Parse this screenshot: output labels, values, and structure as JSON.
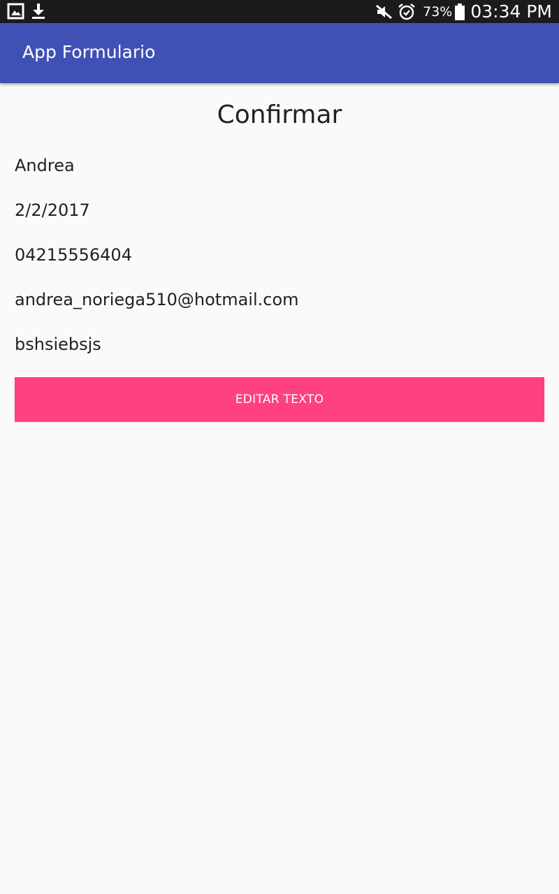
{
  "status_bar": {
    "left_icons": [
      "gallery-icon",
      "download-icon"
    ],
    "right_icons": [
      "mute-icon",
      "alarm-icon",
      "battery-icon"
    ],
    "battery_percent": "73%",
    "time": "03:34 PM"
  },
  "app_bar": {
    "title": "App Formulario",
    "color": "#3f51b5"
  },
  "main": {
    "heading": "Confirmar",
    "fields": {
      "name": "Andrea",
      "date": "2/2/2017",
      "phone": "04215556404",
      "email": "andrea_noriega510@hotmail.com",
      "description": "bshsiebsjs"
    },
    "edit_button_label": "EDITAR TEXTO",
    "edit_button_color": "#ff4081"
  }
}
